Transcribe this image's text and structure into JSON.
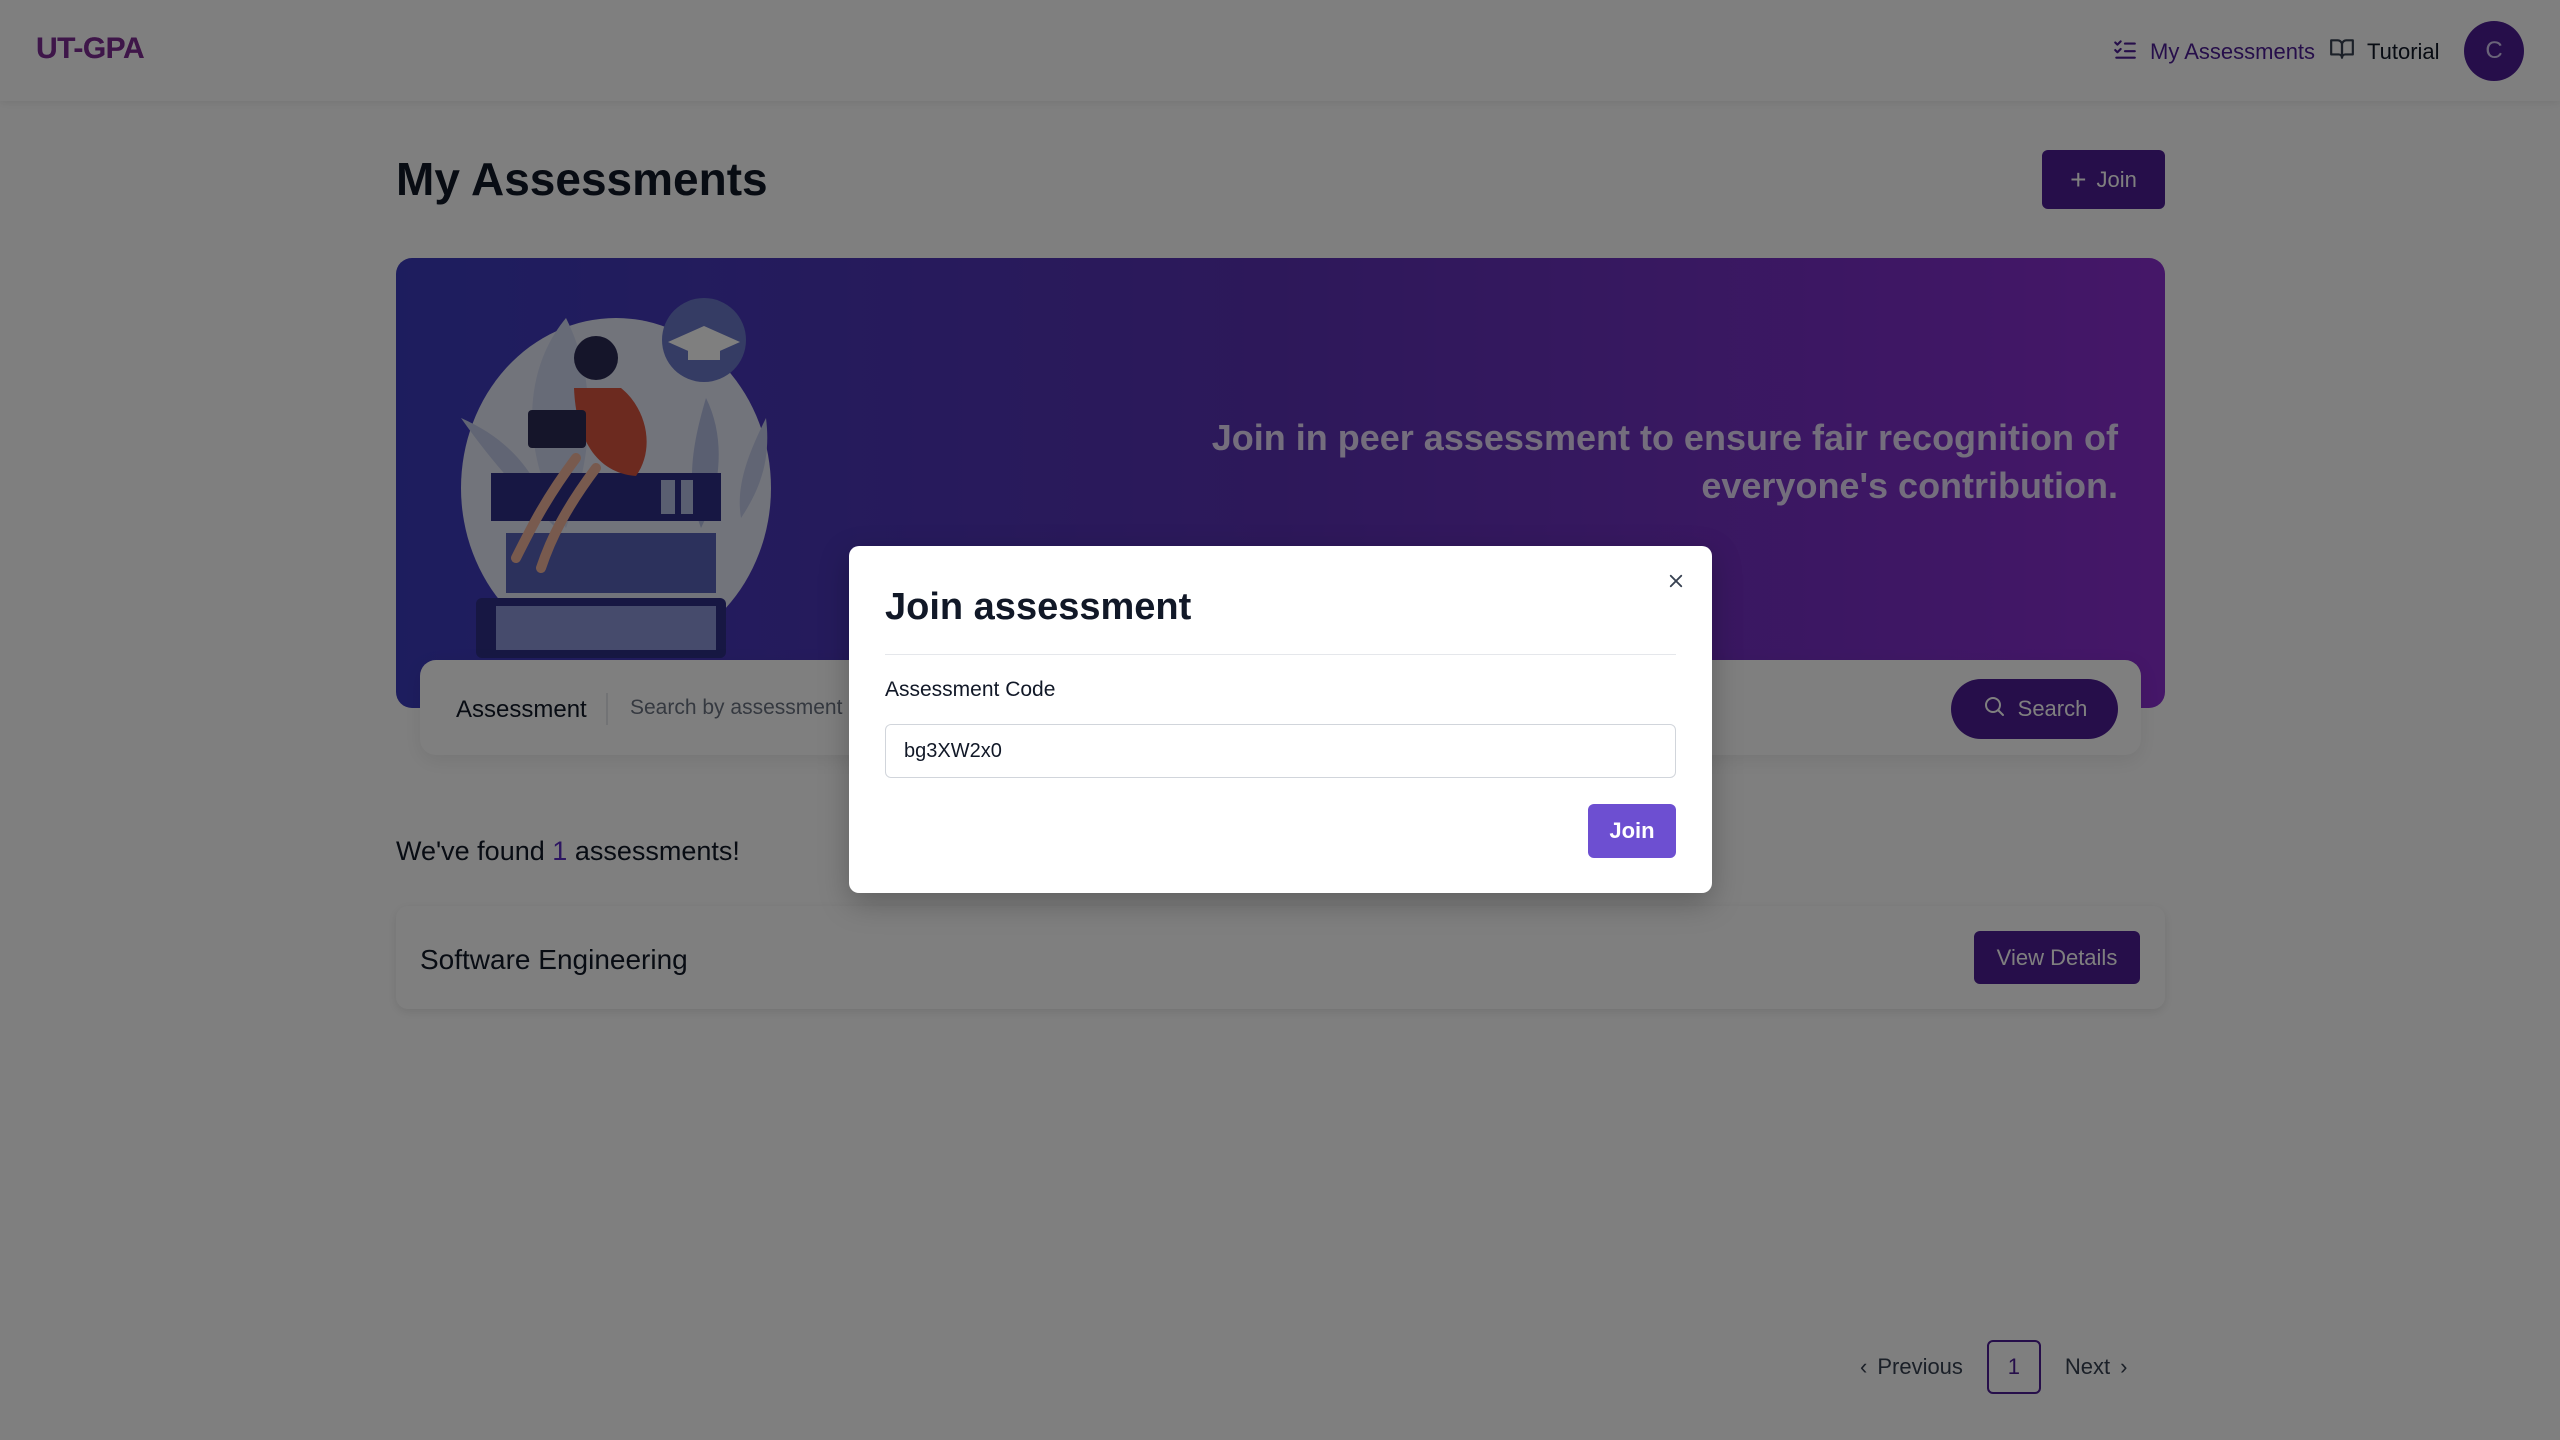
{
  "app": {
    "logo": "UT-GPA"
  },
  "nav": {
    "my_assessments": "My Assessments",
    "tutorial": "Tutorial",
    "avatar_initial": "C"
  },
  "page": {
    "title": "My Assessments",
    "join_label": "Join"
  },
  "hero": {
    "text": "Join in peer assessment to ensure fair recognition of everyone's contribution."
  },
  "search": {
    "label": "Assessment",
    "placeholder": "Search by assessment name",
    "button": "Search"
  },
  "results": {
    "prefix": "We've found",
    "count": "1",
    "suffix": "assessments!",
    "items": [
      {
        "title": "Software Engineering",
        "button": "View Details"
      }
    ]
  },
  "pagination": {
    "previous": "Previous",
    "current": "1",
    "next": "Next"
  },
  "modal": {
    "title": "Join assessment",
    "field_label": "Assessment Code",
    "code_value": "bg3XW2x0",
    "join_button": "Join"
  },
  "colors": {
    "primary": "#4c1d95",
    "modal_button": "#6d4fd1",
    "hero_start": "#3b3bbd",
    "hero_end": "#8b2ed1"
  }
}
